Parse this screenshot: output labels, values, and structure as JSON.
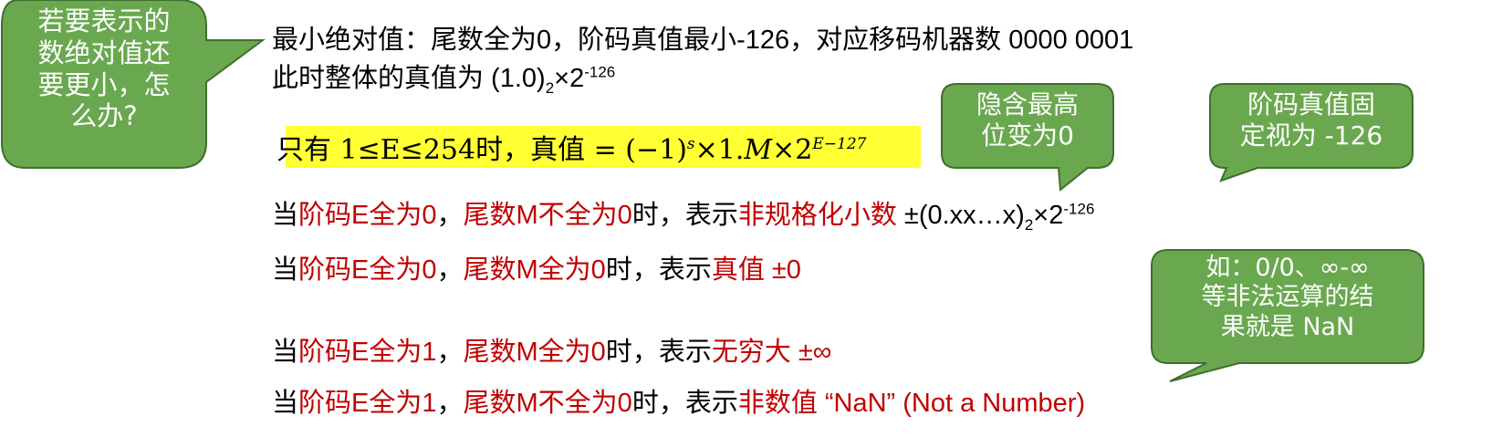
{
  "bubbles": {
    "left": "若要表示的数绝对值还要更小，怎么办?",
    "left_lines": [
      "若要表示的",
      "数绝对值还",
      "要更小，怎",
      "么办?"
    ],
    "hidden_bit": [
      "隐含最高",
      "位变为0"
    ],
    "exponent": [
      "阶码真值固",
      "定视为 -126"
    ],
    "nan_note": [
      "如：0/0、∞-∞",
      "等非法运算的结",
      "果就是 NaN"
    ]
  },
  "lines": {
    "min_abs": "最小绝对值：尾数全为0，阶码真值最小-126，对应移码机器数 0000 0001",
    "true_value_prefix": "此时整体的真值为 (1.0)",
    "true_value_sub": "2",
    "true_value_mid": "×2",
    "true_value_exp": "-126",
    "only_when": "只有 ",
    "range": "1≤E≤254",
    "time_true": "时，真值 = (−1)",
    "s": "s",
    "times1": "×1.",
    "M": "M",
    "times2": "×2",
    "exp_formula": "E−127"
  },
  "cases": [
    {
      "prefix": "当",
      "e_part": "阶码E全为0",
      "sep": "，",
      "m_part": "尾数M不全为0",
      "mid": "时，表示",
      "result": "非规格化小数",
      "extra_prefix": " ±(0.xx…x)",
      "extra_sub": "2",
      "extra_mid": "×2",
      "extra_exp": "-126"
    },
    {
      "prefix": "当",
      "e_part": "阶码E全为0",
      "sep": "，",
      "m_part": "尾数M全为0",
      "mid": "时，表示",
      "result": "真值 ±0"
    },
    {
      "prefix": "当",
      "e_part": "阶码E全为1",
      "sep": "，",
      "m_part": "尾数M全为0",
      "mid": "时，表示",
      "result": "无穷大 ±∞"
    },
    {
      "prefix": "当",
      "e_part": "阶码E全为1",
      "sep": "，",
      "m_part": "尾数M不全为0",
      "mid": "时，表示",
      "result": "非数值 “NaN” (Not a Number)"
    }
  ],
  "colors": {
    "bubble_fill": "#6aa84f",
    "bubble_stroke": "#3f6f2e",
    "highlight": "#ffff33",
    "emphasis": "#c00000"
  }
}
